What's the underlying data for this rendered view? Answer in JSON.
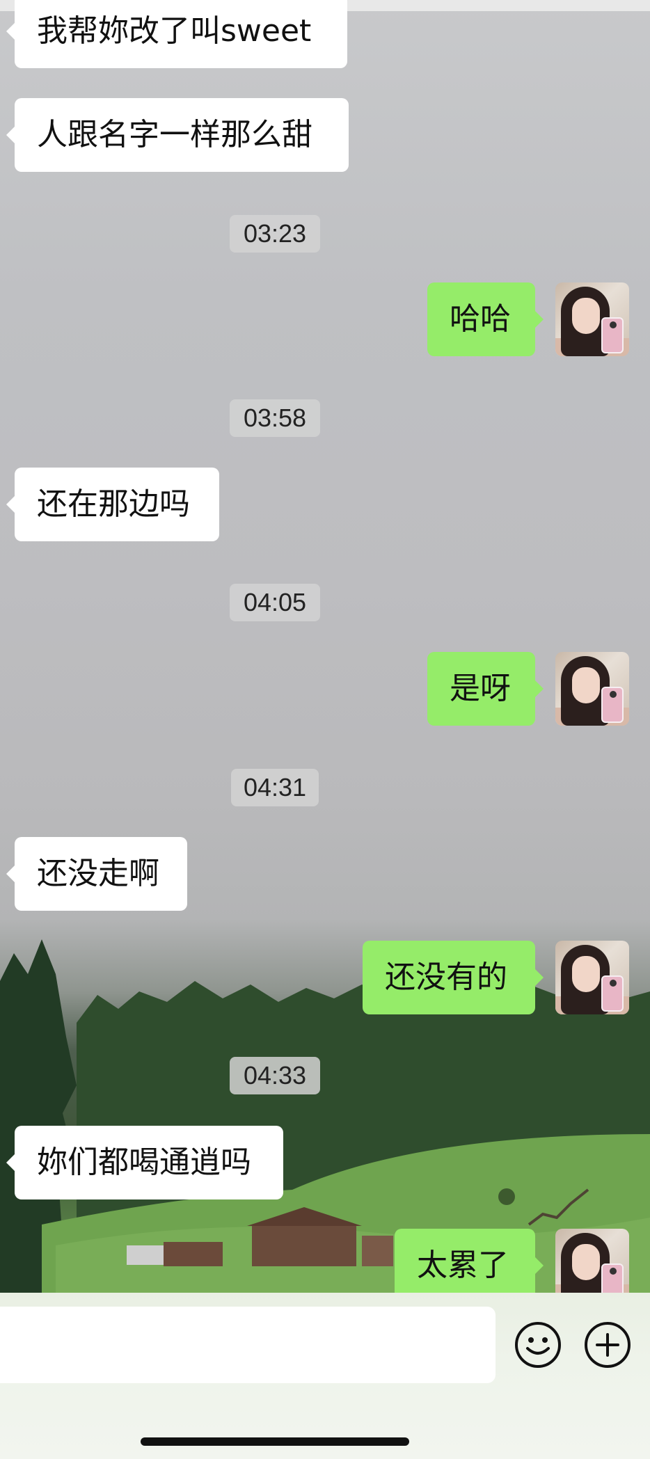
{
  "messages": [
    {
      "side": "left",
      "text": "我帮妳改了叫sweet"
    },
    {
      "side": "left",
      "text": "人跟名字一样那么甜"
    },
    {
      "type": "time",
      "text": "03:23"
    },
    {
      "side": "right",
      "text": "哈哈"
    },
    {
      "type": "time",
      "text": "03:58"
    },
    {
      "side": "left",
      "text": "还在那边吗"
    },
    {
      "type": "time",
      "text": "04:05"
    },
    {
      "side": "right",
      "text": "是呀"
    },
    {
      "type": "time",
      "text": "04:31"
    },
    {
      "side": "left",
      "text": "还没走啊"
    },
    {
      "side": "right",
      "text": "还没有的"
    },
    {
      "type": "time",
      "text": "04:33"
    },
    {
      "side": "left",
      "text": "妳们都喝通逍吗"
    },
    {
      "side": "right",
      "text": "太累了"
    }
  ],
  "input": {
    "value": "",
    "placeholder": ""
  },
  "icons": {
    "emoji": "emoji-icon",
    "more": "plus-icon"
  },
  "colors": {
    "outgoing_bubble": "#95ec69",
    "incoming_bubble": "#ffffff",
    "timestamp_bg": "#d2d2d2"
  }
}
